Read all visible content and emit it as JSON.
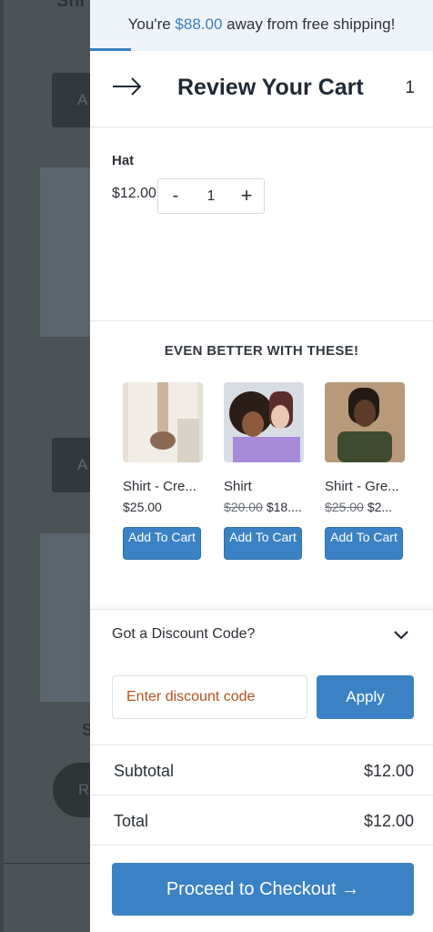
{
  "shipping": {
    "prefix": "You're ",
    "amount": "$88.00",
    "suffix": " away from free shipping!",
    "progress": 0.12
  },
  "header": {
    "title": "Review Your Cart",
    "count": "1"
  },
  "cart_items": [
    {
      "name": "Hat",
      "price": "$12.00",
      "quantity": "1"
    }
  ],
  "upsell": {
    "title": "EVEN BETTER WITH THESE!",
    "products": [
      {
        "name": "Shirt - Cre...",
        "price": "$25.00",
        "old_price": "",
        "button": "Add To Cart"
      },
      {
        "name": "Shirt",
        "price": "$18....",
        "old_price": "$20.00",
        "button": "Add To Cart"
      },
      {
        "name": "Shirt - Gre...",
        "price": "$2...",
        "old_price": "$25.00",
        "button": "Add To Cart"
      }
    ]
  },
  "discount": {
    "label": "Got a Discount Code?",
    "placeholder": "Enter discount code",
    "apply": "Apply"
  },
  "summary": {
    "subtotal_label": "Subtotal",
    "subtotal": "$12.00",
    "total_label": "Total",
    "total": "$12.00"
  },
  "checkout": {
    "label": "Proceed to Checkout →"
  },
  "colors": {
    "accent": "#3a82c4",
    "placeholder": "#b4541e",
    "shipping_bg": "#eef4fa"
  }
}
